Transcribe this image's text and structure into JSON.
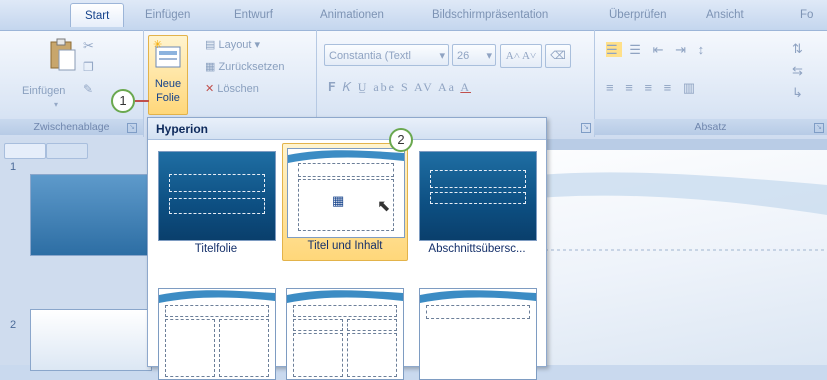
{
  "tabs": [
    "Start",
    "Einfügen",
    "Entwurf",
    "Animationen",
    "Bildschirmpräsentation",
    "Überprüfen",
    "Ansicht",
    "Fo"
  ],
  "groups": {
    "clipboard": {
      "paste_label": "Einfügen",
      "group_label": "Zwischenablage"
    },
    "slides": {
      "new_slide_line1": "Neue",
      "new_slide_line2": "Folie",
      "layout": "Layout",
      "reset": "Zurücksetzen",
      "delete": "Löschen"
    },
    "font": {
      "font_name": "Constantia (Textl",
      "font_size": "26"
    },
    "paragraph": {
      "group_label": "Absatz"
    }
  },
  "gallery": {
    "theme_name": "Hyperion",
    "layouts": [
      "Titelfolie",
      "Titel und Inhalt",
      "Abschnittsübersc..."
    ],
    "selected_index": 1
  },
  "slides_panel": {
    "slide_numbers": [
      "1",
      "2"
    ]
  },
  "callouts": [
    "1",
    "2"
  ],
  "colors": {
    "accent": "#15428b",
    "selection": "#ffd77a",
    "callout_border": "#6aa84f"
  }
}
